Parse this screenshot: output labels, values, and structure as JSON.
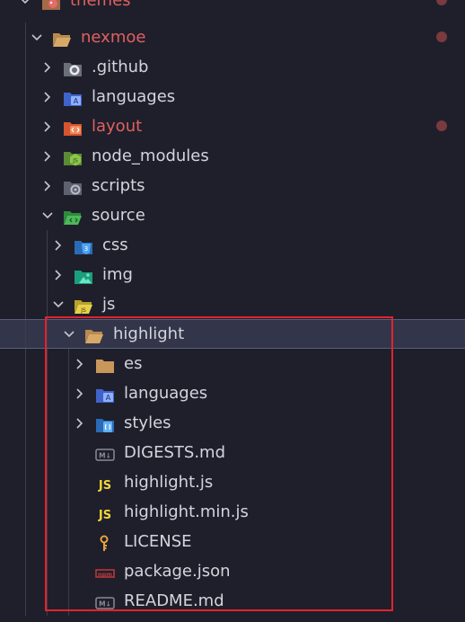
{
  "tree": [
    {
      "label": "themes",
      "red": true,
      "modified": true,
      "expanded": true,
      "icon": "themes-folder-icon"
    },
    {
      "label": "nexmoe",
      "red": true,
      "modified": true,
      "expanded": true,
      "icon": "folder-open-icon"
    },
    {
      "label": ".github",
      "expanded": false,
      "icon": "github-folder-icon"
    },
    {
      "label": "languages",
      "expanded": false,
      "icon": "languages-folder-icon"
    },
    {
      "label": "layout",
      "red": true,
      "modified": true,
      "expanded": false,
      "icon": "layout-folder-icon"
    },
    {
      "label": "node_modules",
      "expanded": false,
      "icon": "node-modules-folder-icon"
    },
    {
      "label": "scripts",
      "expanded": false,
      "icon": "scripts-folder-icon"
    },
    {
      "label": "source",
      "expanded": true,
      "icon": "source-folder-icon"
    },
    {
      "label": "css",
      "expanded": false,
      "icon": "css-folder-icon"
    },
    {
      "label": "img",
      "expanded": false,
      "icon": "images-folder-icon"
    },
    {
      "label": "js",
      "expanded": true,
      "icon": "js-folder-icon"
    },
    {
      "label": "highlight",
      "expanded": true,
      "selected": true,
      "icon": "folder-open-icon"
    },
    {
      "label": "es",
      "expanded": false,
      "icon": "folder-icon"
    },
    {
      "label": "languages",
      "expanded": false,
      "icon": "languages-folder-icon"
    },
    {
      "label": "styles",
      "expanded": false,
      "icon": "styles-folder-icon"
    },
    {
      "label": "DIGESTS.md",
      "icon": "markdown-file-icon"
    },
    {
      "label": "highlight.js",
      "icon": "js-file-icon"
    },
    {
      "label": "highlight.min.js",
      "icon": "js-file-icon"
    },
    {
      "label": "LICENSE",
      "icon": "license-file-icon"
    },
    {
      "label": "package.json",
      "icon": "npm-file-icon"
    },
    {
      "label": "README.md",
      "icon": "markdown-file-icon"
    }
  ],
  "icon_text": {
    "js": "JS",
    "md": "M↓",
    "npm": "npm",
    "css": "3",
    "globe": "A"
  },
  "colors": {
    "modified_text": "#e06060",
    "highlight_border": "#e5222c",
    "background": "#1e1f2b"
  }
}
